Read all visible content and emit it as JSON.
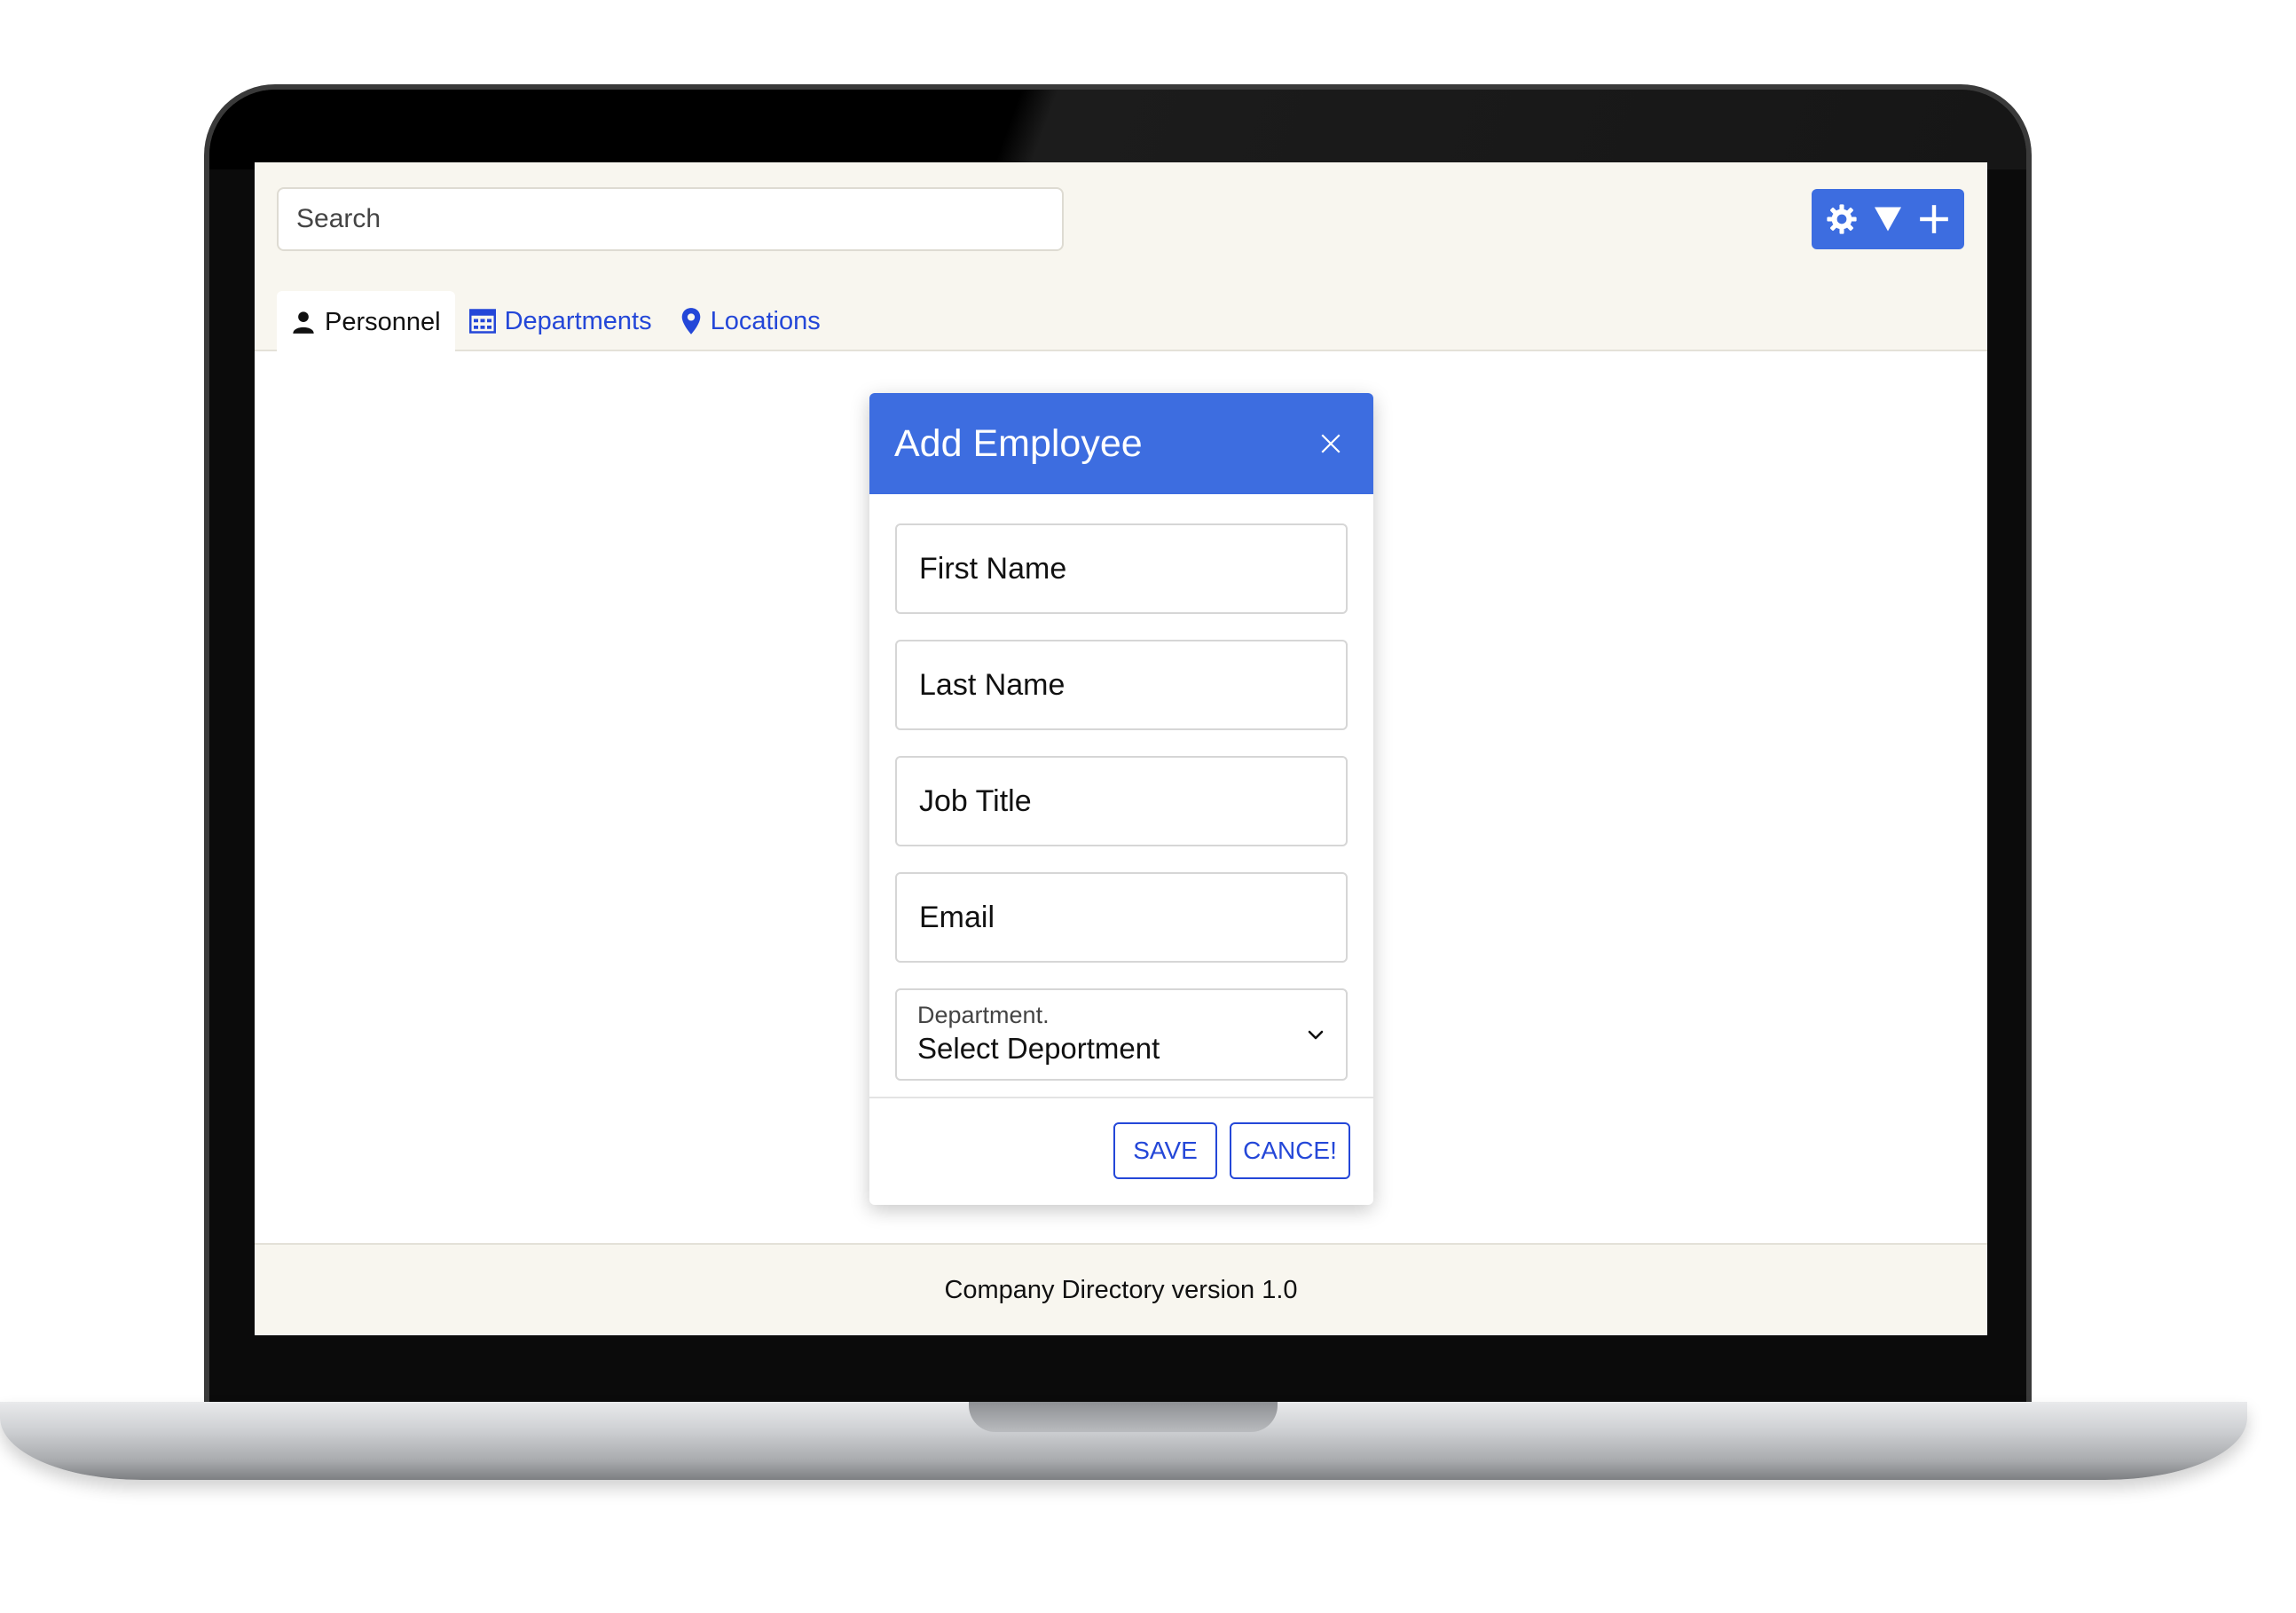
{
  "header": {
    "search_placeholder": "Search",
    "actions": {
      "settings_icon": "gear-icon",
      "filter_icon": "filter-icon",
      "add_icon": "plus-icon"
    }
  },
  "tabs": [
    {
      "label": "Personnel",
      "icon": "person-icon",
      "active": true
    },
    {
      "label": "Departments",
      "icon": "building-icon",
      "active": false
    },
    {
      "label": "Locations",
      "icon": "map-pin-icon",
      "active": false
    }
  ],
  "modal": {
    "title": "Add Employee",
    "first_name_placeholder": "First Name",
    "last_name_placeholder": "Last Name",
    "job_title_placeholder": "Job Title",
    "email_placeholder": "Email",
    "department_label": "Department.",
    "department_value": "Select Deportment",
    "save_label": "SAVE",
    "cancel_label": "CANCE!"
  },
  "footer": {
    "text": "Company Directory version 1.0"
  },
  "colors": {
    "accent": "#3d6de0",
    "link": "#2447d8",
    "header_bg": "#f8f6ef"
  }
}
